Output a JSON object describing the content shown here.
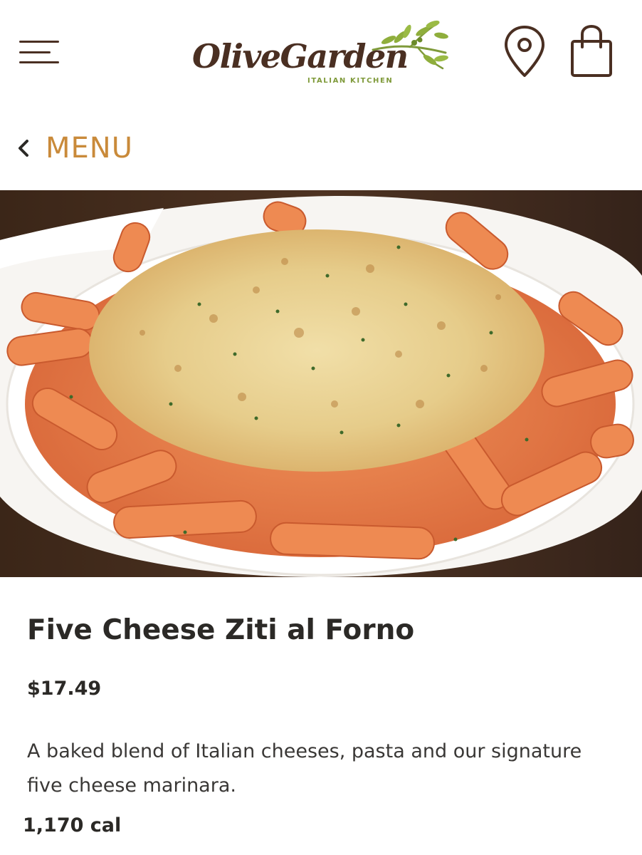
{
  "header": {
    "menu_icon": "hamburger-menu-icon",
    "logo": {
      "wordmark": "OliveGarden",
      "tagline": "ITALIAN KITCHEN",
      "emblem_icon": "olive-branch-icon"
    },
    "location_icon": "location-pin-icon",
    "bag_icon": "shopping-bag-icon"
  },
  "nav": {
    "back_icon": "chevron-left-icon",
    "back_label": "MENU"
  },
  "item": {
    "image_subject": "baked ziti pasta dish",
    "name": "Five Cheese Ziti al Forno",
    "price": "$17.49",
    "description": "A baked blend of Italian cheeses, pasta and our signature five cheese marinara.",
    "calories": "1,170 cal"
  },
  "colors": {
    "brand_brown": "#4a2f22",
    "brand_green": "#7f9a3a",
    "accent_gold": "#c98a3a",
    "text_dark": "#2b2926"
  }
}
